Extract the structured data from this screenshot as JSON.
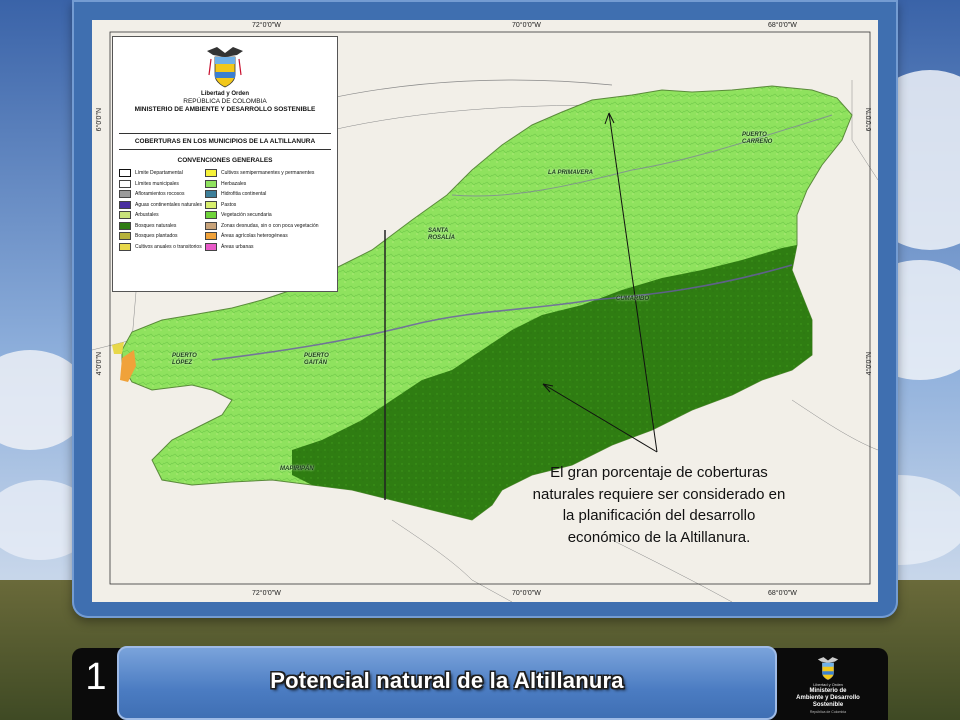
{
  "map": {
    "top_ticks": [
      "72°0'0\"W",
      "70°0'0\"W",
      "68°0'0\"W"
    ],
    "bottom_ticks": [
      "72°0'0\"W",
      "70°0'0\"W",
      "68°0'0\"W"
    ],
    "left_ticks": [
      "6°0'0\"N",
      "4°0'0\"N"
    ],
    "right_ticks": [
      "6°0'0\"N",
      "4°0'0\"N"
    ],
    "places": [
      {
        "label": "PUERTO CARREÑO"
      },
      {
        "label": "LA PRIMAVERA"
      },
      {
        "label": "SANTA ROSALÍA"
      },
      {
        "label": "CUMARIBO"
      },
      {
        "label": "PUERTO LÓPEZ"
      },
      {
        "label": "PUERTO GAITÁN"
      },
      {
        "label": "MAPIRIPÁN"
      }
    ],
    "colors": {
      "herbazales": "#8fe25e",
      "bosques_naturales": "#2f7d12",
      "background": "#f2efe8"
    }
  },
  "legend": {
    "motto": "Libertad y Orden",
    "republic": "REPÚBLICA DE COLOMBIA",
    "ministry": "MINISTERIO DE AMBIENTE Y DESARROLLO SOSTENIBLE",
    "title": "COBERTURAS EN LOS MUNICIPIOS DE LA ALTILLANURA",
    "conventions_title": "CONVENCIONES GENERALES",
    "left_items": [
      {
        "label": "Límite Departamental",
        "color": "#ffffff"
      },
      {
        "label": "Límites municipales",
        "color": "#ffffff"
      },
      {
        "label": "Afloramientos rocosos",
        "color": "#9a9a9a"
      },
      {
        "label": "Aguas continentales naturales",
        "color": "#4a2fa0"
      },
      {
        "label": "Arbustales",
        "color": "#c9e27a"
      },
      {
        "label": "Bosques naturales",
        "color": "#2f7d12"
      },
      {
        "label": "Bosques plantados",
        "color": "#b6b23a"
      },
      {
        "label": "Cultivos anuales o transitorios",
        "color": "#e8d84a"
      }
    ],
    "right_items": [
      {
        "label": "Cultivos semipermanentes y permanentes",
        "color": "#f6f23a"
      },
      {
        "label": "Herbazales",
        "color": "#8fe25e"
      },
      {
        "label": "Hidrofitia continental",
        "color": "#3d7f9a"
      },
      {
        "label": "Pastos",
        "color": "#d8ef6e"
      },
      {
        "label": "Vegetación secundaria",
        "color": "#6fd33a"
      },
      {
        "label": "Zonas desnudas, sin o con poca vegetación",
        "color": "#c8a37a"
      },
      {
        "label": "Áreas agrícolas heterogéneas",
        "color": "#f0a23a"
      },
      {
        "label": "Áreas urbanas",
        "color": "#e85ac8"
      }
    ]
  },
  "annotation": {
    "text": "El gran porcentaje de coberturas naturales requiere ser considerado en la planificación del desarrollo económico de la Altillanura."
  },
  "footer": {
    "slide_number": "1",
    "title": "Potencial natural de la Altillanura",
    "logo_line1": "Libertad y Orden",
    "logo_line2": "Ministerio de Ambiente y Desarrollo Sostenible",
    "logo_line3": "República de Colombia"
  }
}
